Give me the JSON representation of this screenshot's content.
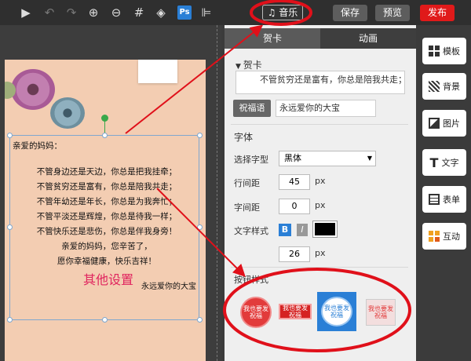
{
  "toolbar": {
    "music_label": "♫ 音乐",
    "save_label": "保存",
    "preview_label": "预览",
    "publish_label": "发布",
    "ps_label": "Ps"
  },
  "canvas": {
    "greeting": "亲爱的妈妈：",
    "lines": [
      "不管身边还是天边，你总是把我挂牵；",
      "不管贫穷还是富有，你总是陪我共走；",
      "不管年幼还是年长，你总是为我奔忙；",
      "不管平淡还是辉煌，你总是待我一样；",
      "不管快乐还是悲伤，你总是伴我身旁！",
      "亲爱的妈妈，您辛苦了，",
      "愿你幸福健康，快乐吉祥！"
    ],
    "other_settings": "其他设置",
    "wish_text": "永远爱你的大宝"
  },
  "panel": {
    "tabs": [
      "贺卡",
      "动画"
    ],
    "card_section": "贺卡",
    "card_text": "不管贫穷还是富有，你总是陪我共走；",
    "blessing_label": "祝福语",
    "blessing_value": "永远爱你的大宝",
    "font_section": "字体",
    "font_type_label": "选择字型",
    "font_type_value": "黑体",
    "line_spacing_label": "行间距",
    "line_spacing_value": "45",
    "letter_spacing_label": "字间距",
    "letter_spacing_value": "0",
    "unit_px": "px",
    "text_style_label": "文字样式",
    "bold_label": "B",
    "italic_label": "I",
    "font_size_value": "26",
    "button_style_section": "按钮样式",
    "button_style_text": "我也要发祝福",
    "button_style_text_short": "我也要发祝福",
    "text_color": "#000000"
  },
  "sidebar": {
    "items": [
      {
        "label": "模板",
        "icon": "template-icon"
      },
      {
        "label": "背景",
        "icon": "background-icon"
      },
      {
        "label": "图片",
        "icon": "image-icon"
      },
      {
        "label": "文字",
        "icon": "text-icon"
      },
      {
        "label": "表单",
        "icon": "form-icon"
      },
      {
        "label": "互动",
        "icon": "interaction-icon"
      }
    ]
  },
  "colors": {
    "accent_red": "#e01a1a",
    "active_blue": "#2a7fd6",
    "annotation_red": "#e0101a"
  }
}
